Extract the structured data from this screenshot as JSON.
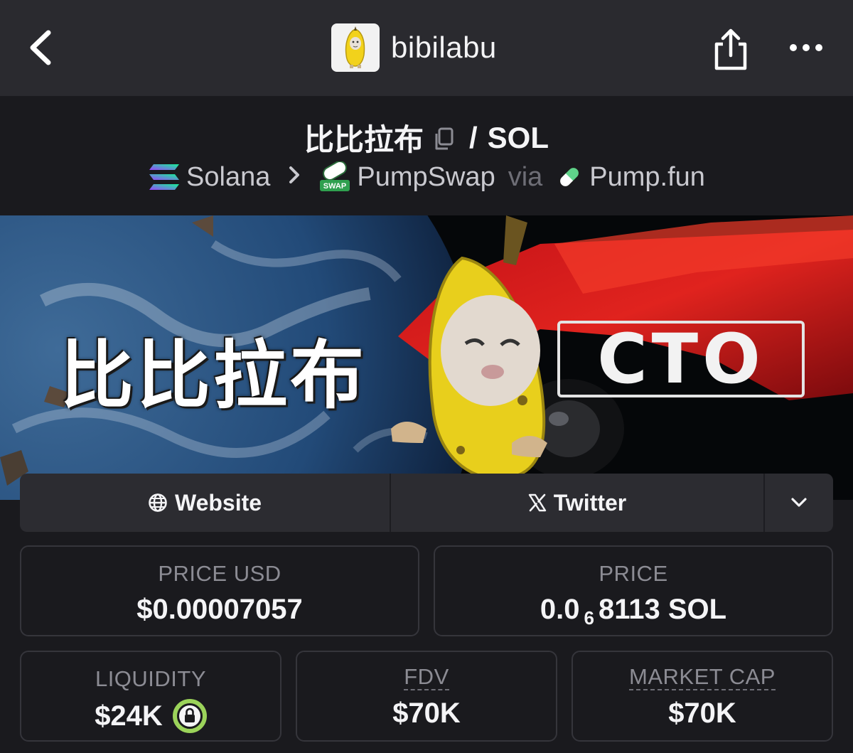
{
  "nav": {
    "back_icon": "chevron-left-icon",
    "brand_name": "bibilabu",
    "share_icon": "share-icon",
    "more_icon": "more-horizontal-icon"
  },
  "pair": {
    "base_token": "比比拉布",
    "separator": "/",
    "quote_token": "SOL",
    "chain": "Solana",
    "dex": "PumpSwap",
    "via_label": "via",
    "launchpad": "Pump.fun"
  },
  "banner": {
    "title_text": "比比拉布",
    "badge_text": "CTO"
  },
  "links": {
    "website_label": "Website",
    "twitter_label": "Twitter"
  },
  "stats": {
    "price_usd_label": "PRICE USD",
    "price_usd_value": "$0.00007057",
    "price_label": "PRICE",
    "price_prefix": "0.0",
    "price_zero_count": "6",
    "price_suffix": "8113 SOL",
    "liquidity_label": "LIQUIDITY",
    "liquidity_value": "$24K",
    "fdv_label": "FDV",
    "fdv_value": "$70K",
    "mcap_label": "MARKET CAP",
    "mcap_value": "$70K"
  },
  "colors": {
    "background": "#1a1a1e",
    "topbar": "#2a2a2f",
    "lock_badge": "#9bd35a",
    "solana_gradient": [
      "#9945ff",
      "#14f195"
    ]
  }
}
